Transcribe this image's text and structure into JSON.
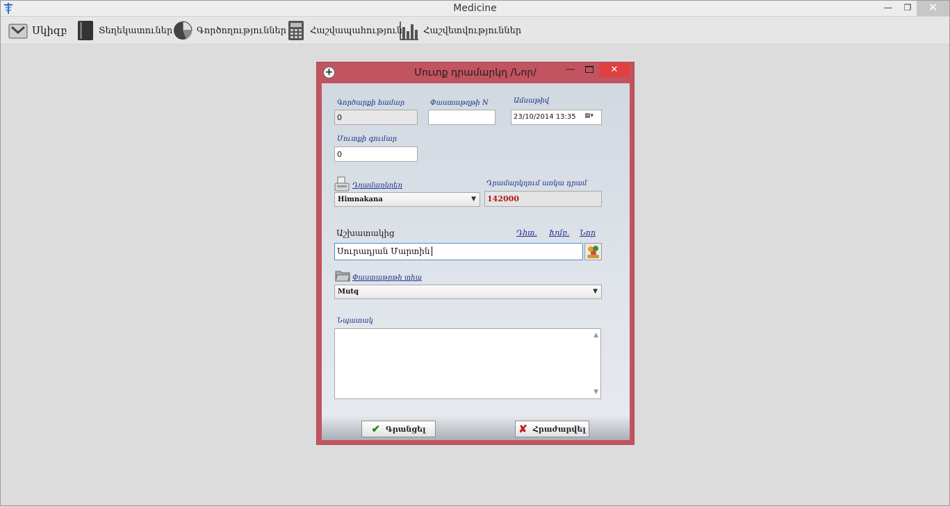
{
  "app": {
    "title": "Medicine",
    "icon": "caduceus-icon",
    "controls": {
      "minimize": "—",
      "restore": "❐",
      "close": "✕"
    }
  },
  "toolbar": {
    "items": [
      {
        "label": "Սկիզբ",
        "icon": "home-inbox-icon"
      },
      {
        "label": "Տեղեկատուներ",
        "icon": "book-icon"
      },
      {
        "label": "Գործողություններ",
        "icon": "pie-chart-icon"
      },
      {
        "label": "Հաշվապահություն",
        "icon": "calculator-icon"
      },
      {
        "label": "Հաշվետվություններ",
        "icon": "bar-chart-icon"
      }
    ]
  },
  "dialog": {
    "title": "Մուտք դրամարկղ /Նոր/",
    "close": "✕",
    "fields": {
      "doc_number": {
        "label": "Գործարքի համար",
        "value": "0"
      },
      "receipt_no": {
        "label": "Փաստաթղթի N",
        "value": ""
      },
      "date": {
        "label": "Ամսաթիվ",
        "value": "23/10/2014 13:35"
      },
      "amount": {
        "label": "Մուտքի գումար",
        "value": "0"
      },
      "cashbox": {
        "label": "Դրամարկղեր",
        "value": "Himnakana"
      },
      "available": {
        "label": "Դրամարկղում առկա դրամ",
        "value": "142000"
      },
      "employee": {
        "label": "Աշխատակից",
        "value": "Սուրադյան Մարտին",
        "links": {
          "edit": "Դիտ.",
          "clear": "Խմբ.",
          "new": "Նոր"
        }
      },
      "doc_type": {
        "label": "Փաստաթղթի տիպ",
        "value": "Mutq"
      },
      "note": {
        "label": "Նպատակ",
        "value": ""
      }
    },
    "buttons": {
      "save": "Գրանցել",
      "cancel": "Հրաժարվել"
    }
  }
}
